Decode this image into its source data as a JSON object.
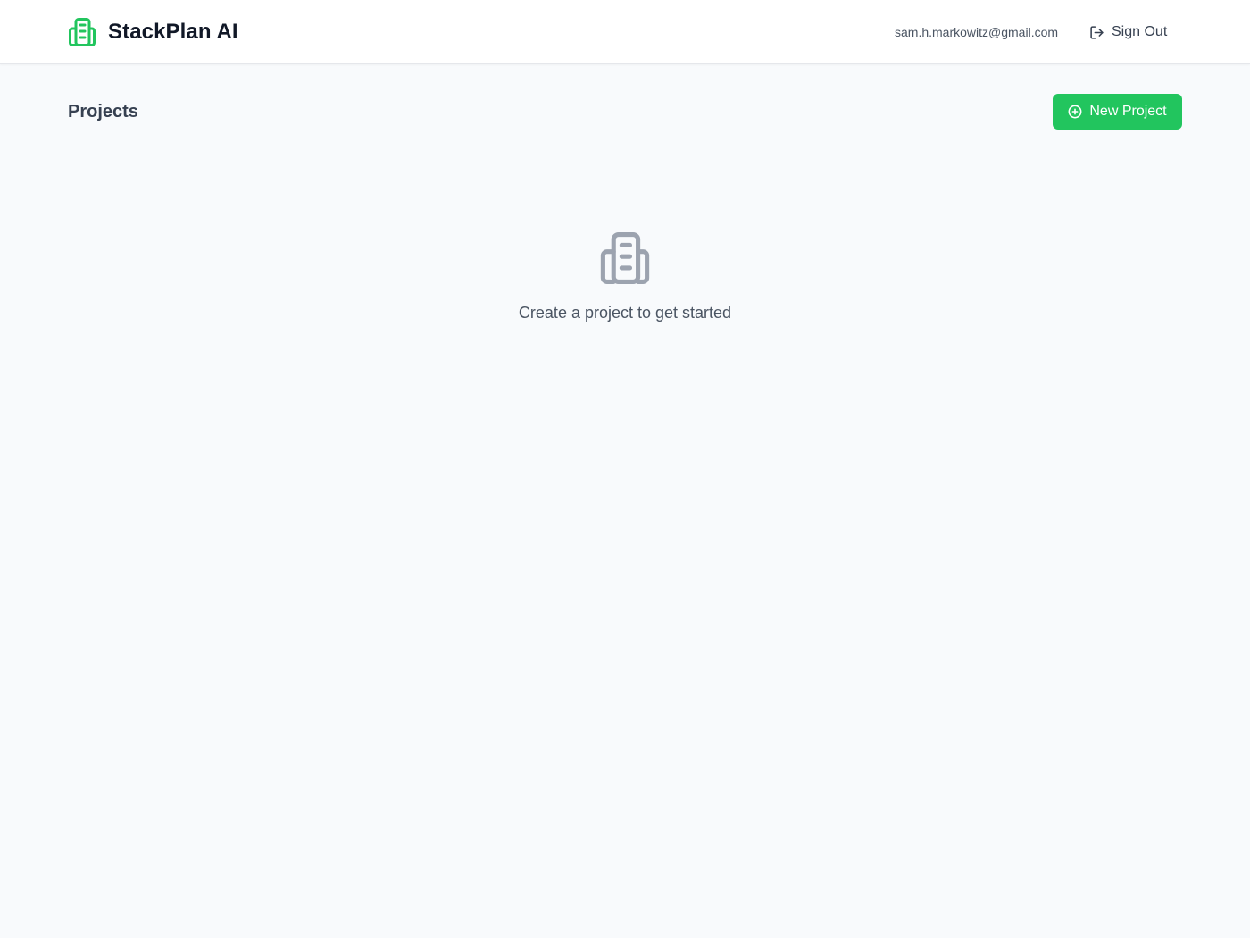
{
  "app": {
    "name": "StackPlan AI",
    "brand_icon": "building-icon",
    "accent_color": "#22c55e"
  },
  "header": {
    "user_email": "sam.h.markowitz@gmail.com",
    "sign_out_label": "Sign Out",
    "sign_out_icon": "log-out-icon"
  },
  "main": {
    "title": "Projects",
    "new_project_label": "New Project",
    "new_project_icon": "plus-circle-icon",
    "empty_state": {
      "icon": "building-icon",
      "message": "Create a project to get started"
    }
  }
}
